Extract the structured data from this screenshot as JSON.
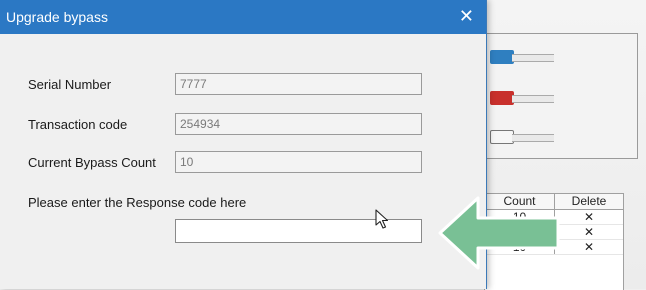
{
  "dialog": {
    "title": "Upgrade bypass",
    "close_glyph": "✕",
    "serial_label": "Serial Number",
    "serial_value": "7777",
    "transaction_label": "Transaction code",
    "transaction_value": "254934",
    "bypass_label": "Current Bypass Count",
    "bypass_value": "10",
    "response_label": "Please enter the Response code here",
    "response_value": ""
  },
  "table": {
    "headers": [
      "Count",
      "Delete"
    ],
    "rows": [
      {
        "count": "10",
        "delete": "✕"
      },
      {
        "count": "",
        "delete": "✕"
      },
      {
        "count": "10",
        "delete": "✕"
      }
    ]
  },
  "colors": {
    "titlebar": "#2b78c4",
    "arrow": "#79c095",
    "connector_blue": "#2f7fc0",
    "connector_red": "#c8302c"
  },
  "icons": [
    "close-icon",
    "mouse-cursor-icon",
    "green-arrow-icon",
    "connector-icon"
  ]
}
